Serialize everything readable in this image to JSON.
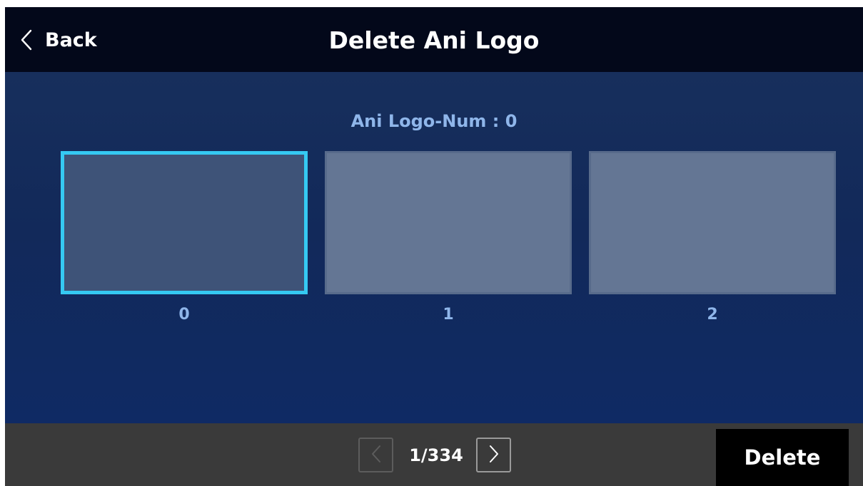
{
  "header": {
    "back_label": "Back",
    "title": "Delete Ani Logo"
  },
  "main": {
    "logo_num_text": "Ani Logo-Num : 0",
    "slots": [
      {
        "label": "0",
        "selected": true
      },
      {
        "label": "1",
        "selected": false
      },
      {
        "label": "2",
        "selected": false
      }
    ]
  },
  "footer": {
    "page_indicator": "1/334",
    "prev_enabled": false,
    "next_enabled": true,
    "delete_label": "Delete"
  },
  "colors": {
    "header_bg": "#03081a",
    "main_bg": "#12295a",
    "footer_bg": "#3a3a3a",
    "selection_accent": "#35c9f2",
    "label_text": "#8fb6ea",
    "slot_fill": "#647694"
  },
  "icons": {
    "back": "chevron-left-icon",
    "prev_page": "chevron-left-icon",
    "next_page": "chevron-right-icon"
  }
}
